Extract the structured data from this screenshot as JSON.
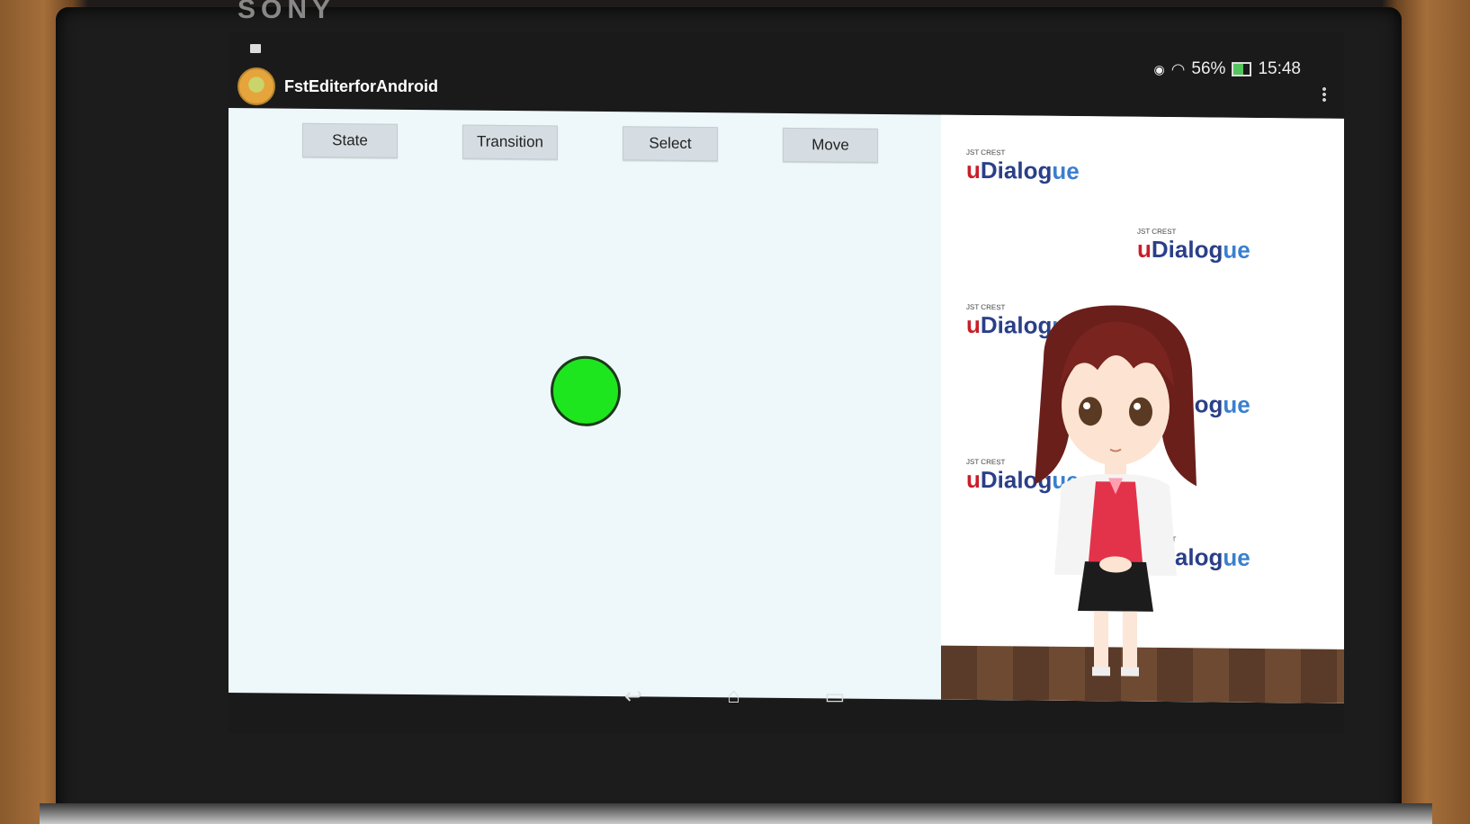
{
  "device": {
    "brand": "SONY"
  },
  "status_bar": {
    "battery": "56%",
    "time": "15:48"
  },
  "action_bar": {
    "title": "FstEditerforAndroid"
  },
  "toolbar": {
    "buttons": [
      {
        "label": "State"
      },
      {
        "label": "Transition"
      },
      {
        "label": "Select"
      },
      {
        "label": "Move"
      }
    ]
  },
  "agent_panel": {
    "logo": {
      "small": "JST CREST",
      "big_u": "u",
      "big_mid": "Dialog",
      "big_end": "ue"
    }
  },
  "canvas": {
    "state_node_color": "#1ee61e"
  },
  "nav_bar": {
    "back_icon": "back-icon",
    "home_icon": "home-icon",
    "recents_icon": "recents-icon"
  }
}
